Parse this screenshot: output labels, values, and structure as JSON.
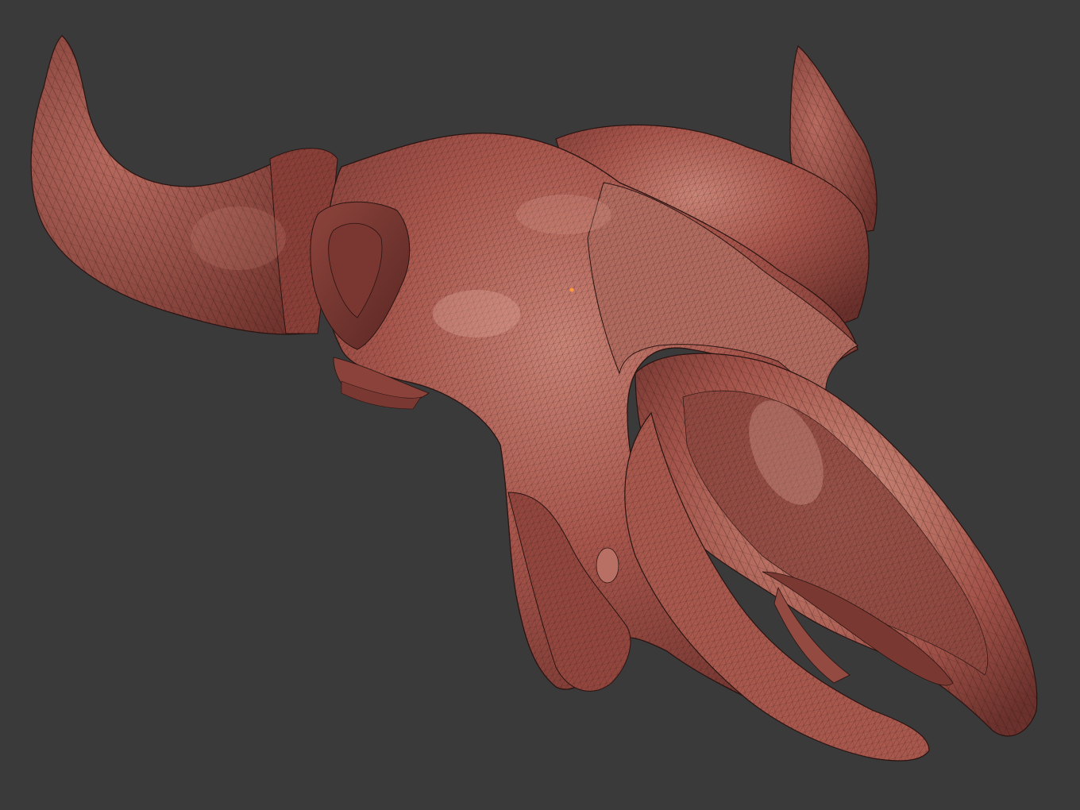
{
  "scene": {
    "background_color": "#3a3a3a",
    "subject": "bison-skull-mesh",
    "render_mode": "wireframe-on-shaded",
    "colors": {
      "surface_base": "#9a4c44",
      "surface_light": "#c27a6e",
      "surface_highlight": "#d99a8e",
      "surface_shadow": "#5e2a26",
      "wire": "#2a1412",
      "selection_marker": "#ff9a3a"
    }
  }
}
